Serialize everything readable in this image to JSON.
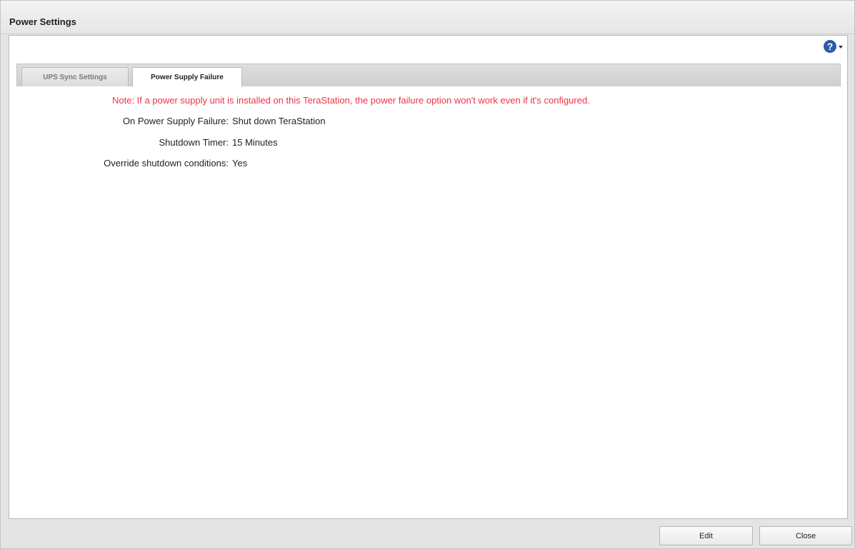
{
  "window": {
    "title": "Power Settings"
  },
  "help": {
    "icon_glyph": "?",
    "icon": "help-icon",
    "accent_color": "#2f5aa6"
  },
  "tabs": [
    {
      "label": "UPS Sync Settings",
      "active": false
    },
    {
      "label": "Power Supply Failure",
      "active": true
    }
  ],
  "main": {
    "note": "Note: If a power supply unit is installed on this TeraStation, the power failure option won't work even if it's configured.",
    "note_color": "#ee3344",
    "fields": [
      {
        "label": "On Power Supply Failure:",
        "value": "Shut down TeraStation"
      },
      {
        "label": "Shutdown Timer:",
        "value": "15 Minutes"
      },
      {
        "label": "Override shutdown conditions:",
        "value": "Yes"
      }
    ]
  },
  "footer": {
    "edit_label": "Edit",
    "close_label": "Close"
  }
}
